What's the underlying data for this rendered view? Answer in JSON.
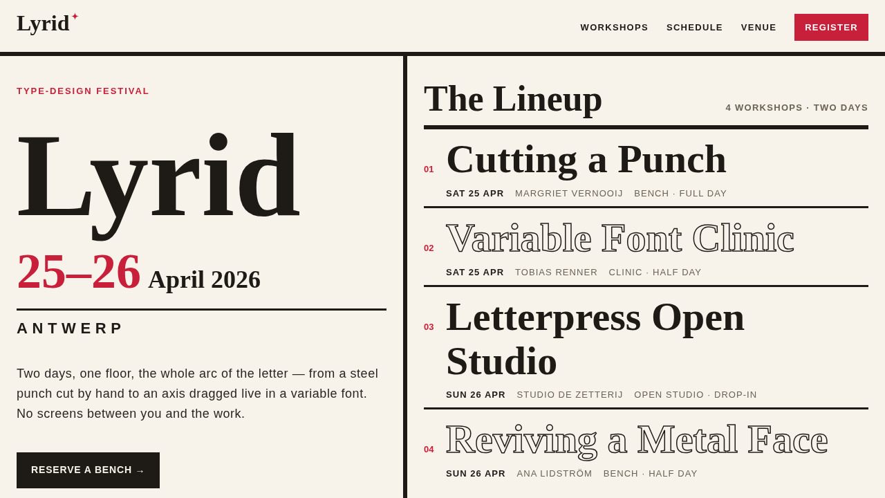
{
  "header": {
    "logo": "Lyrid",
    "nav": [
      {
        "label": "WORKSHOPS"
      },
      {
        "label": "SCHEDULE"
      },
      {
        "label": "VENUE"
      }
    ],
    "register_button": "REGISTER"
  },
  "hero": {
    "eyebrow": "TYPE-DESIGN FESTIVAL",
    "title": "Lyrid",
    "dates": "25–26",
    "month_year": "April 2026",
    "city": "ANTWERP",
    "description": "Two days, one floor, the whole arc of the letter — from a steel punch cut by hand to an axis dragged live in a variable font. No screens between you and the work.",
    "cta": "RESERVE A BENCH →"
  },
  "lineup": {
    "title": "The Lineup",
    "summary": "4 WORKSHOPS · TWO DAYS",
    "workshops": [
      {
        "number": "01",
        "title": "Cutting a Punch",
        "outlined": false,
        "day": "SAT 25 APR",
        "host": "MARGRIET VERNOOIJ",
        "format": "BENCH · FULL DAY"
      },
      {
        "number": "02",
        "title": "Variable Font Clinic",
        "outlined": true,
        "day": "SAT 25 APR",
        "host": "TOBIAS RENNER",
        "format": "CLINIC · HALF DAY"
      },
      {
        "number": "03",
        "title": "Letterpress Open Studio",
        "outlined": false,
        "day": "SUN 26 APR",
        "host": "STUDIO DE ZETTERIJ",
        "format": "OPEN STUDIO · DROP-IN"
      },
      {
        "number": "04",
        "title": "Reviving a Metal Face",
        "outlined": true,
        "day": "SUN 26 APR",
        "host": "ANA LIDSTRÖM",
        "format": "BENCH · HALF DAY"
      }
    ]
  }
}
